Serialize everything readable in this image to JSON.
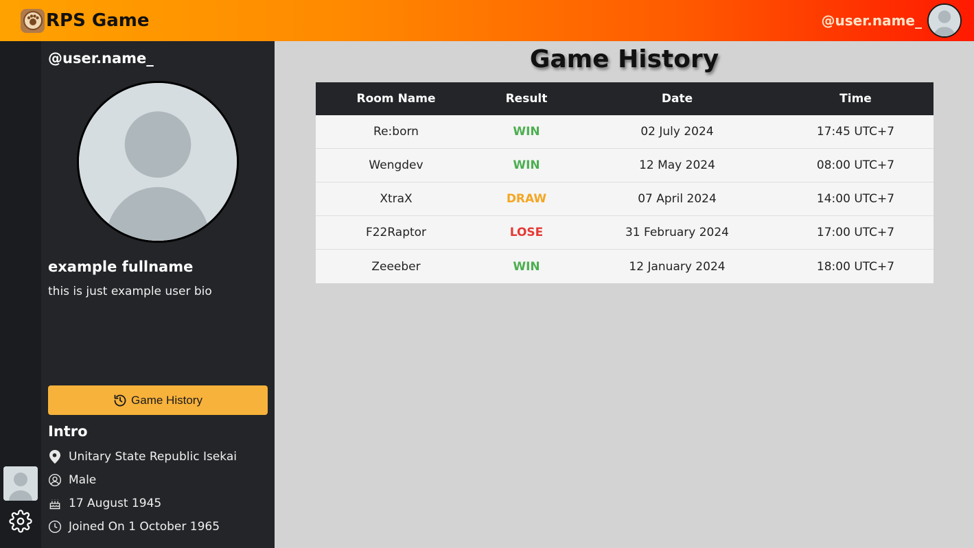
{
  "header": {
    "app_name": "RPS Game",
    "username": "@user.name_"
  },
  "profile": {
    "username": "@user.name_",
    "fullname": "example fullname",
    "bio": "this is just example user bio",
    "history_button_label": "Game History",
    "intro_heading": "Intro",
    "info": [
      {
        "icon": "location-pin-icon",
        "text": "Unitary State Republic Isekai"
      },
      {
        "icon": "user-circle-icon",
        "text": "Male"
      },
      {
        "icon": "birthday-cake-icon",
        "text": "17 August 1945"
      },
      {
        "icon": "clock-icon",
        "text": "Joined On 1 October 1965"
      }
    ]
  },
  "main": {
    "title": "Game History",
    "columns": [
      "Room Name",
      "Result",
      "Date",
      "Time"
    ],
    "rows": [
      {
        "room": "Re:born",
        "result": "WIN",
        "date": "02 July 2024",
        "time": "17:45 UTC+7"
      },
      {
        "room": "Wengdev",
        "result": "WIN",
        "date": "12 May 2024",
        "time": "08:00 UTC+7"
      },
      {
        "room": "XtraX",
        "result": "DRAW",
        "date": "07 April 2024",
        "time": "14:00 UTC+7"
      },
      {
        "room": "F22Raptor",
        "result": "LOSE",
        "date": "31 February 2024",
        "time": "17:00 UTC+7"
      },
      {
        "room": "Zeeeber",
        "result": "WIN",
        "date": "12 January 2024",
        "time": "18:00 UTC+7"
      }
    ]
  },
  "colors": {
    "win": "#4caf50",
    "draw": "#f5a623",
    "lose": "#e53935",
    "accent": "#f7b23b"
  }
}
